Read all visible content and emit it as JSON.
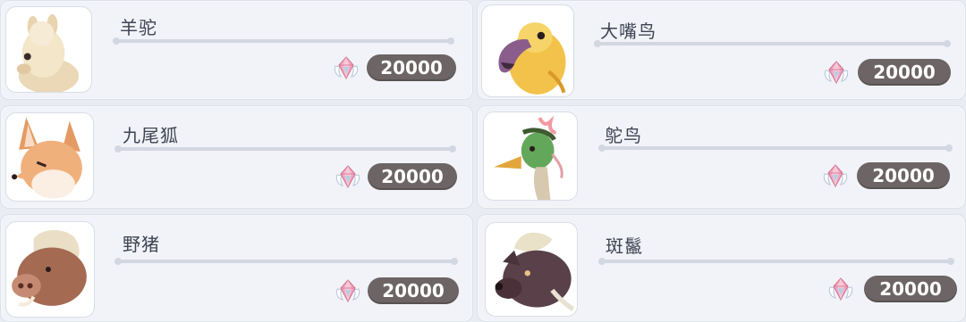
{
  "currency_icon": "winged-crystal-icon",
  "colors": {
    "price_pill": "#6c6465",
    "card_bg": "#f1f3f8",
    "name_text": "#3f4352"
  },
  "items": [
    {
      "name": "羊驼",
      "price": "20000",
      "icon": "alpaca-portrait"
    },
    {
      "name": "大嘴鸟",
      "price": "20000",
      "icon": "big-beak-bird-portrait"
    },
    {
      "name": "九尾狐",
      "price": "20000",
      "icon": "nine-tailed-fox-portrait"
    },
    {
      "name": "鸵鸟",
      "price": "20000",
      "icon": "ostrich-portrait"
    },
    {
      "name": "野猪",
      "price": "20000",
      "icon": "wild-boar-portrait"
    },
    {
      "name": "斑鬣",
      "price": "20000",
      "icon": "hyena-portrait"
    }
  ]
}
